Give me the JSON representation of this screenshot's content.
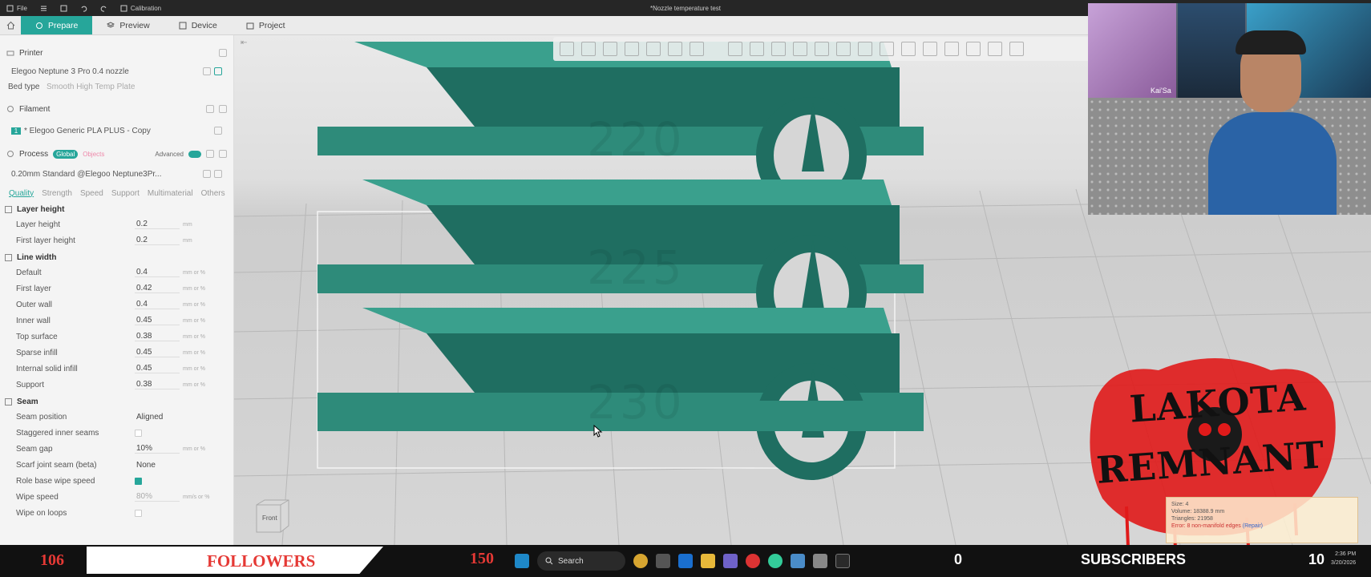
{
  "titlebar": {
    "file_label": "File",
    "calibration_label": "Calibration",
    "window_title": "*Nozzle temperature test"
  },
  "tabs": [
    {
      "label": "Prepare"
    },
    {
      "label": "Preview"
    },
    {
      "label": "Device"
    },
    {
      "label": "Project"
    }
  ],
  "sidebar": {
    "printer_label": "Printer",
    "printer_value": "Elegoo Neptune 3 Pro 0.4 nozzle",
    "bedtype_label": "Bed type",
    "bedtype_value": "Smooth High Temp Plate",
    "filament_label": "Filament",
    "filament_index": "1",
    "filament_value": "* Elegoo Generic PLA PLUS - Copy",
    "process_label": "Process",
    "global_label": "Global",
    "objects_label": "Objects",
    "advanced_label": "Advanced",
    "process_value": "0.20mm Standard @Elegoo Neptune3Pr...",
    "quality_tabs": [
      "Quality",
      "Strength",
      "Speed",
      "Support",
      "Multimaterial",
      "Others"
    ],
    "layer_height_group": "Layer height",
    "layer_props": [
      {
        "label": "Layer height",
        "value": "0.2",
        "unit": "mm"
      },
      {
        "label": "First layer height",
        "value": "0.2",
        "unit": "mm"
      }
    ],
    "line_width_group": "Line width",
    "line_props": [
      {
        "label": "Default",
        "value": "0.4",
        "unit": "mm or %"
      },
      {
        "label": "First layer",
        "value": "0.42",
        "unit": "mm or %"
      },
      {
        "label": "Outer wall",
        "value": "0.4",
        "unit": "mm or %"
      },
      {
        "label": "Inner wall",
        "value": "0.45",
        "unit": "mm or %"
      },
      {
        "label": "Top surface",
        "value": "0.38",
        "unit": "mm or %"
      },
      {
        "label": "Sparse infill",
        "value": "0.45",
        "unit": "mm or %"
      },
      {
        "label": "Internal solid infill",
        "value": "0.45",
        "unit": "mm or %"
      },
      {
        "label": "Support",
        "value": "0.38",
        "unit": "mm or %"
      }
    ],
    "seam_group": "Seam",
    "seam_props": [
      {
        "label": "Seam position",
        "value": "Aligned",
        "unit": ""
      },
      {
        "label": "Staggered inner seams",
        "value": "",
        "unit": ""
      },
      {
        "label": "Seam gap",
        "value": "10%",
        "unit": "mm or %"
      },
      {
        "label": "Scarf joint seam (beta)",
        "value": "None",
        "unit": ""
      },
      {
        "label": "Role base wipe speed",
        "value": "",
        "unit": ""
      },
      {
        "label": "Wipe speed",
        "value": "80%",
        "unit": "mm/s or %"
      },
      {
        "label": "Wipe on loops",
        "value": "",
        "unit": ""
      }
    ]
  },
  "viewport": {
    "cube_label": "Front",
    "model_color": "#2e8b7a",
    "plate_labels": [
      "220",
      "225",
      "230"
    ]
  },
  "info_panel": {
    "size_label": "Size: 4",
    "volume": "Volume: 18388.9 mm",
    "triangles": "Triangles: 21958",
    "error": "Error: 8 non-manifold edges",
    "repair": "(Repair)"
  },
  "webcam": {
    "name_tag": "Kai'Sa"
  },
  "logo": {
    "line1": "LAKOTA",
    "line2": "REMNANT"
  },
  "footer": {
    "followers_count": "106",
    "followers_label": "FOLLOWERS",
    "goal": "150",
    "search_label": "Search",
    "subs_count": "0",
    "subs_label": "SUBSCRIBERS",
    "subs_goal": "10",
    "clock_time": "2:36 PM",
    "clock_date": "3/20/2026"
  },
  "colors": {
    "accent": "#26a69a",
    "stream_red": "#e53935"
  }
}
